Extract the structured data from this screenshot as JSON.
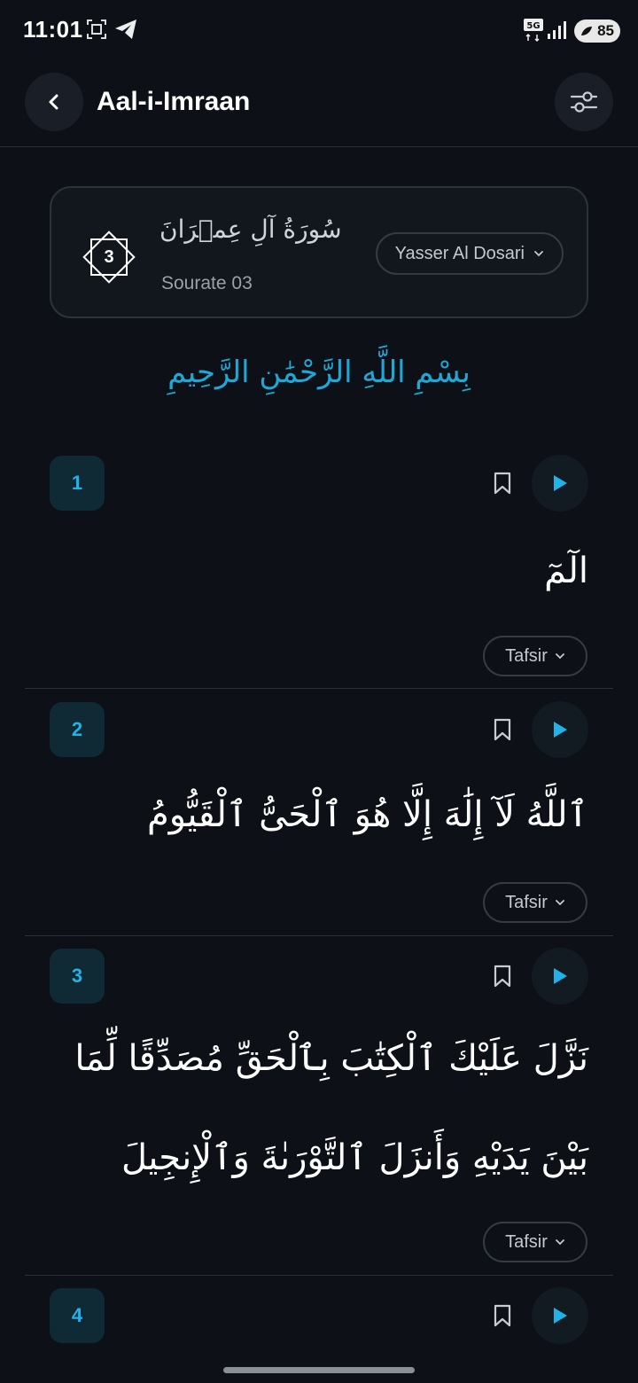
{
  "status_bar": {
    "time": "11:01",
    "network": "5G",
    "battery": "85"
  },
  "header": {
    "title": "Aal-i-Imraan"
  },
  "surah_card": {
    "number": "3",
    "calligraphy": "سُورَةُ آلِ عِمۡرَانَ",
    "subtitle": "Sourate 03",
    "reciter": "Yasser Al Dosari"
  },
  "bismillah": "بِسْمِ اللَّهِ الرَّحْمَٰنِ الرَّحِيمِ",
  "verses": [
    {
      "number": "1",
      "text": "الٓمٓ",
      "tafsir_label": "Tafsir"
    },
    {
      "number": "2",
      "text": "ٱللَّهُ لَآ إِلَٰهَ إِلَّا هُوَ ٱلْحَىُّ ٱلْقَيُّومُ",
      "tafsir_label": "Tafsir"
    },
    {
      "number": "3",
      "text_line1": "نَزَّلَ عَلَيْكَ ٱلْكِتَٰبَ بِٱلْحَقِّ مُصَدِّقًا لِّمَا",
      "text_line2": "بَيْنَ يَدَيْهِ وَأَنزَلَ ٱلتَّوْرَىٰةَ وَٱلْإِنجِيلَ",
      "tafsir_label": "Tafsir"
    },
    {
      "number": "4"
    }
  ],
  "colors": {
    "background": "#0d1117",
    "accent": "#1fb3e8",
    "bismillah": "#1fa8d6"
  }
}
